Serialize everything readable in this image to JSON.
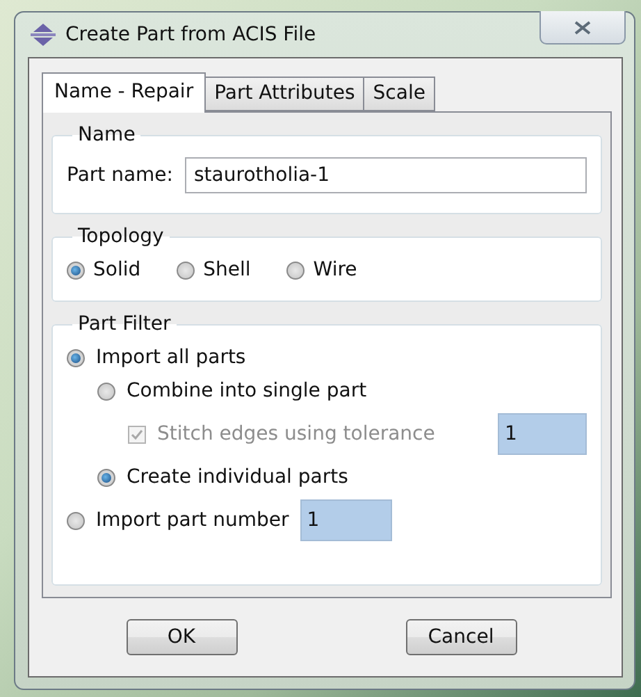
{
  "window": {
    "title": "Create Part from ACIS File"
  },
  "tabs": [
    {
      "label": "Name - Repair",
      "selected": true
    },
    {
      "label": "Part Attributes",
      "selected": false
    },
    {
      "label": "Scale",
      "selected": false
    }
  ],
  "name_group": {
    "title": "Name",
    "label": "Part name:",
    "value": "staurotholia-1"
  },
  "topology": {
    "title": "Topology",
    "options": [
      {
        "label": "Solid",
        "selected": true
      },
      {
        "label": "Shell",
        "selected": false
      },
      {
        "label": "Wire",
        "selected": false
      }
    ]
  },
  "part_filter": {
    "title": "Part Filter",
    "items": [
      {
        "kind": "radio",
        "label": "Import all parts",
        "selected": true,
        "children": [
          {
            "kind": "radio",
            "label": "Combine into single part",
            "selected": false,
            "children": [
              {
                "kind": "checkbox",
                "label": "Stitch edges using tolerance",
                "checked": true,
                "disabled": true,
                "value": "1"
              }
            ]
          },
          {
            "kind": "radio",
            "label": "Create individual parts",
            "selected": true
          }
        ]
      },
      {
        "kind": "radio",
        "label": "Import part number",
        "selected": false,
        "value": "1"
      }
    ]
  },
  "buttons": [
    "OK",
    "Cancel"
  ]
}
